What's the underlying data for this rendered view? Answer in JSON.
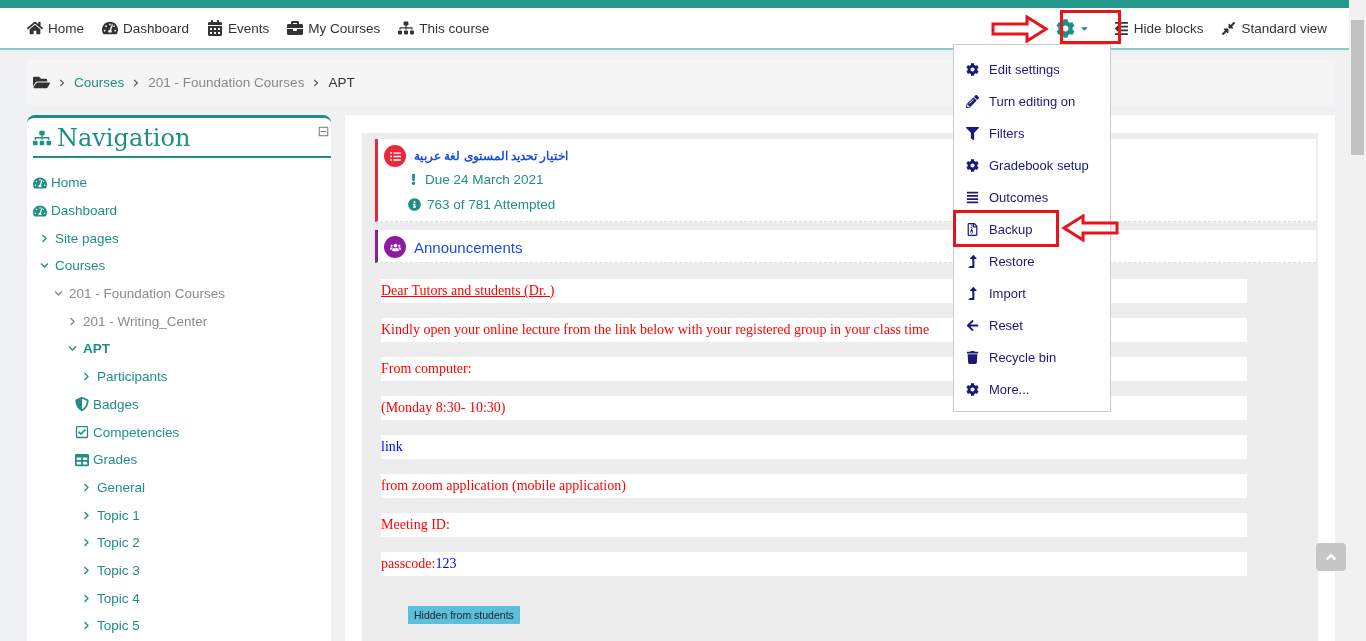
{
  "navbar": {
    "items": [
      {
        "label": "Home"
      },
      {
        "label": "Dashboard"
      },
      {
        "label": "Events"
      },
      {
        "label": "My Courses"
      },
      {
        "label": "This course"
      }
    ],
    "right": [
      {
        "label": "Hide blocks"
      },
      {
        "label": "Standard view"
      }
    ]
  },
  "settings_menu": {
    "expanded": true,
    "items": [
      {
        "label": "Edit settings"
      },
      {
        "label": "Turn editing on"
      },
      {
        "label": "Filters"
      },
      {
        "label": "Gradebook setup"
      },
      {
        "label": "Outcomes"
      },
      {
        "label": "Backup"
      },
      {
        "label": "Restore"
      },
      {
        "label": "Import"
      },
      {
        "label": "Reset"
      },
      {
        "label": "Recycle bin"
      },
      {
        "label": "More..."
      }
    ]
  },
  "breadcrumb": [
    {
      "label": "Courses",
      "kind": "link"
    },
    {
      "label": "201 - Foundation Courses",
      "kind": "muted"
    },
    {
      "label": "APT",
      "kind": "current"
    }
  ],
  "navigation": {
    "title": "Navigation",
    "items": [
      {
        "label": "Home",
        "kind": "leaf",
        "selected": false,
        "muted": false
      },
      {
        "label": "Dashboard",
        "kind": "leaf",
        "selected": false,
        "muted": false
      },
      {
        "label": "Site pages",
        "kind": "branch",
        "expanded": false,
        "selected": false,
        "muted": false
      },
      {
        "label": "Courses",
        "kind": "branch",
        "expanded": true,
        "selected": false,
        "muted": false,
        "children": [
          {
            "label": "201 - Foundation Courses",
            "kind": "branch",
            "expanded": true,
            "selected": false,
            "muted": true,
            "children": [
              {
                "label": "201 - Writing_Center",
                "kind": "branch",
                "expanded": false,
                "selected": false,
                "muted": true
              },
              {
                "label": "APT",
                "kind": "branch",
                "expanded": true,
                "selected": true,
                "muted": false,
                "children": [
                  {
                    "label": "Participants",
                    "kind": "branch",
                    "expanded": false,
                    "selected": false,
                    "muted": false
                  },
                  {
                    "label": "Badges",
                    "kind": "leaf",
                    "selected": false,
                    "muted": false
                  },
                  {
                    "label": "Competencies",
                    "kind": "leaf",
                    "selected": false,
                    "muted": false
                  },
                  {
                    "label": "Grades",
                    "kind": "leaf",
                    "selected": false,
                    "muted": false
                  },
                  {
                    "label": "General",
                    "kind": "branch",
                    "expanded": false,
                    "selected": false,
                    "muted": false
                  },
                  {
                    "label": "Topic 1",
                    "kind": "branch",
                    "expanded": false,
                    "selected": false,
                    "muted": false
                  },
                  {
                    "label": "Topic 2",
                    "kind": "branch",
                    "expanded": false,
                    "selected": false,
                    "muted": false
                  },
                  {
                    "label": "Topic 3",
                    "kind": "branch",
                    "expanded": false,
                    "selected": false,
                    "muted": false
                  },
                  {
                    "label": "Topic 4",
                    "kind": "branch",
                    "expanded": false,
                    "selected": false,
                    "muted": false
                  },
                  {
                    "label": "Topic 5",
                    "kind": "branch",
                    "expanded": false,
                    "selected": false,
                    "muted": false
                  }
                ]
              }
            ]
          }
        ]
      }
    ]
  },
  "activities": [
    {
      "kind": "quiz",
      "color": "#ee2738",
      "title": "اختيار تحديد المستوى لغة عربية",
      "details": [
        {
          "kind": "due",
          "text": "Due 24 March 2021"
        },
        {
          "kind": "info",
          "text": "763 of 781 Attempted"
        }
      ]
    },
    {
      "kind": "forum",
      "color": "#8e1aa0",
      "title": "Announcements"
    }
  ],
  "announcement": {
    "lines": [
      {
        "parts": [
          {
            "kind": "underlined",
            "text": "Dear Tutors and students (Dr. )"
          }
        ]
      },
      {
        "parts": [
          {
            "kind": "plain",
            "text": "Kindly open your online lecture from the link below with your registered group in your class time"
          }
        ]
      },
      {
        "parts": [
          {
            "kind": "plain",
            "text": "From computer:"
          }
        ]
      },
      {
        "parts": [
          {
            "kind": "plain",
            "text": "(Monday 8:30- 10:30)"
          }
        ]
      },
      {
        "parts": [
          {
            "kind": "link",
            "text": "link"
          }
        ]
      },
      {
        "parts": [
          {
            "kind": "plain",
            "text": "from zoom application (mobile application)"
          }
        ]
      },
      {
        "parts": [
          {
            "kind": "plain",
            "text": "Meeting ID:"
          }
        ]
      },
      {
        "parts": [
          {
            "kind": "plain",
            "text": "passcode:"
          },
          {
            "kind": "link",
            "text": "123"
          }
        ]
      }
    ],
    "badge": "Hidden from students"
  }
}
